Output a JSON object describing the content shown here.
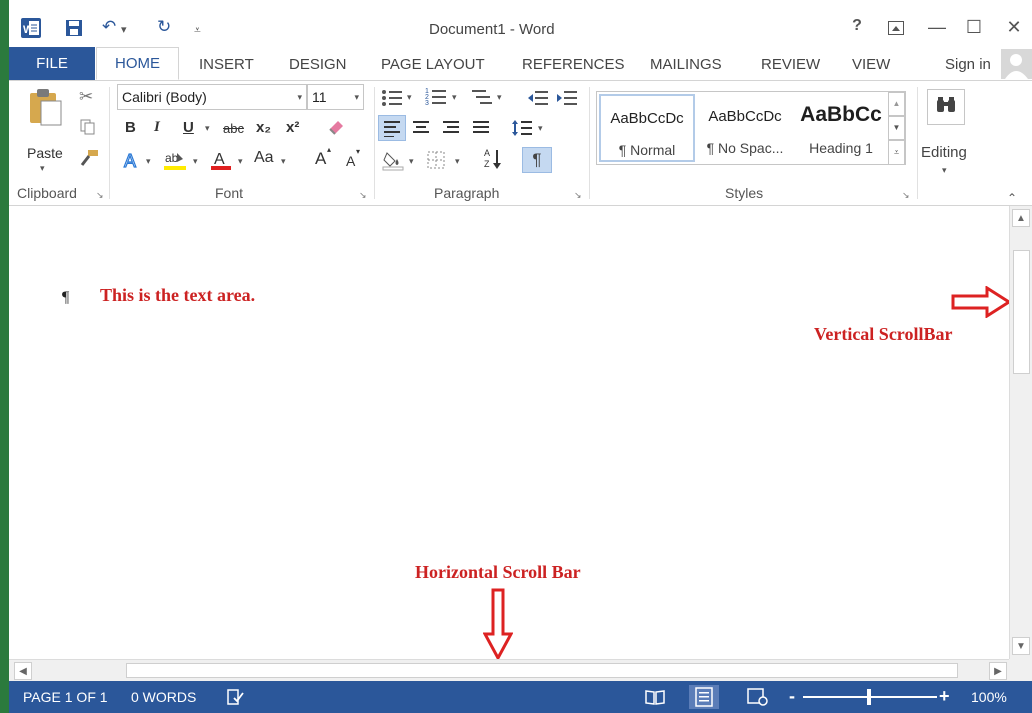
{
  "window": {
    "title": "Document1 - Word",
    "help": "?",
    "minimize": "—",
    "maximize": "☐",
    "close": "✕"
  },
  "quick_access": {
    "undo": "↶",
    "dropdown": "▾",
    "redo": "↻",
    "customize": "⩡"
  },
  "tabs": {
    "file": "FILE",
    "items": [
      "HOME",
      "INSERT",
      "DESIGN",
      "PAGE LAYOUT",
      "REFERENCES",
      "MAILINGS",
      "REVIEW",
      "VIEW"
    ],
    "sign_in": "Sign in"
  },
  "ribbon": {
    "clipboard": {
      "label": "Clipboard",
      "paste": "Paste"
    },
    "font": {
      "label": "Font",
      "family": "Calibri (Body)",
      "size": "11",
      "bold": "B",
      "italic": "I",
      "underline": "U",
      "strike": "abc",
      "subscript": "x₂",
      "superscript": "x²",
      "grow": "A",
      "shrink": "A",
      "case": "Aa"
    },
    "paragraph": {
      "label": "Paragraph",
      "pilcrow": "¶"
    },
    "styles": {
      "label": "Styles",
      "items": [
        {
          "preview": "AaBbCcDc",
          "name": "¶ Normal"
        },
        {
          "preview": "AaBbCcDc",
          "name": "¶ No Spac..."
        },
        {
          "preview": "AaBbCc",
          "name": "Heading 1"
        }
      ]
    },
    "editing": {
      "label": "Editing"
    }
  },
  "document": {
    "pilcrow": "¶",
    "text_area_note": "This is the text area.",
    "vertical_note": "Vertical ScrollBar",
    "horizontal_note": "Horizontal Scroll Bar"
  },
  "status": {
    "page": "PAGE 1 OF 1",
    "words": "0 WORDS",
    "zoom": "100%",
    "zoom_minus": "-",
    "zoom_plus": "+"
  },
  "colors": {
    "accent": "#2b579a",
    "annotation": "#cc2222"
  }
}
